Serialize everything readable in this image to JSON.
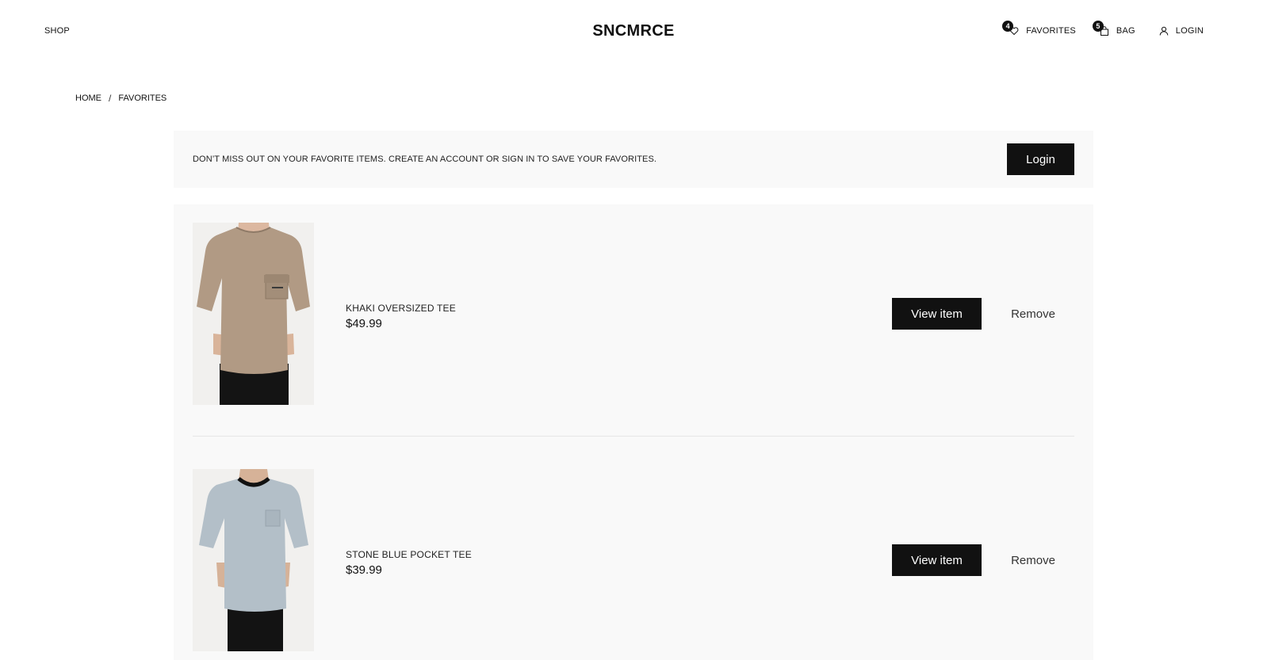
{
  "header": {
    "shop_label": "SHOP",
    "logo": "SNCMRCE",
    "favorites_label": "FAVORITES",
    "favorites_count": "4",
    "bag_label": "BAG",
    "bag_count": "5",
    "login_label": "LOGIN"
  },
  "breadcrumb": {
    "home": "HOME",
    "separator": "/",
    "current": "FAVORITES"
  },
  "notice": {
    "text": "DON’T MISS OUT ON YOUR FAVORITE ITEMS. CREATE AN ACCOUNT OR SIGN IN TO SAVE YOUR FAVORITES.",
    "login_button": "Login"
  },
  "favorites": {
    "items": [
      {
        "name": "KHAKI OVERSIZED TEE",
        "price": "$49.99",
        "view_label": "View item",
        "remove_label": "Remove",
        "shirt_color": "#b19a84"
      },
      {
        "name": "STONE BLUE POCKET TEE",
        "price": "$39.99",
        "view_label": "View item",
        "remove_label": "Remove",
        "shirt_color": "#b3bfc8"
      }
    ]
  },
  "colors": {
    "primary": "#111111",
    "panel_bg": "#f9f9f9",
    "divider": "#e6e6e6"
  }
}
